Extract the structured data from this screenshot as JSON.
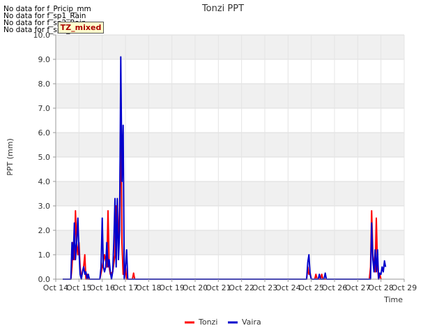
{
  "notes": [
    "No data for f_Pricip_mm",
    "No data for f_sp1_Rain",
    "No data for f_sp2_Rain",
    "No data for f_sp3_Rain"
  ],
  "badge": "TZ_mixed",
  "chart_data": {
    "type": "line",
    "title": "Tonzi PPT",
    "xlabel": "Time",
    "ylabel": "PPT (mm)",
    "xlim": [
      14,
      29
    ],
    "ylim": [
      0,
      10
    ],
    "x_ticks": [
      14,
      15,
      16,
      17,
      18,
      19,
      20,
      21,
      22,
      23,
      24,
      25,
      26,
      27,
      28,
      29
    ],
    "x_tick_labels": [
      "Oct 14",
      "Oct 15",
      "Oct 16",
      "Oct 17",
      "Oct 18",
      "Oct 19",
      "Oct 20",
      "Oct 21",
      "Oct 22",
      "Oct 23",
      "Oct 24",
      "Oct 25",
      "Oct 26",
      "Oct 27",
      "Oct 28",
      "Oct 29"
    ],
    "y_ticks": [
      0,
      1,
      2,
      3,
      4,
      5,
      6,
      7,
      8,
      9,
      10
    ],
    "y_tick_labels": [
      "0.0",
      "1.0",
      "2.0",
      "3.0",
      "4.0",
      "5.0",
      "6.0",
      "7.0",
      "8.0",
      "9.0",
      "10.0"
    ],
    "legend_position": "bottom-center",
    "grid": true,
    "series": [
      {
        "name": "Tonzi",
        "color": "#ff0000",
        "points": [
          [
            14.3,
            0
          ],
          [
            14.65,
            0
          ],
          [
            14.7,
            0.5
          ],
          [
            14.75,
            1.5
          ],
          [
            14.8,
            0.8
          ],
          [
            14.85,
            2.8
          ],
          [
            14.9,
            1.5
          ],
          [
            14.95,
            1.0
          ],
          [
            15.0,
            1.5
          ],
          [
            15.05,
            0.5
          ],
          [
            15.1,
            0
          ],
          [
            15.15,
            0.3
          ],
          [
            15.2,
            0.5
          ],
          [
            15.25,
            1.0
          ],
          [
            15.3,
            0
          ],
          [
            15.35,
            0.2
          ],
          [
            15.4,
            0
          ],
          [
            15.9,
            0
          ],
          [
            16.0,
            0.5
          ],
          [
            16.1,
            1.0
          ],
          [
            16.2,
            0.5
          ],
          [
            16.25,
            2.8
          ],
          [
            16.3,
            0.5
          ],
          [
            16.35,
            0.2
          ],
          [
            16.45,
            0.3
          ],
          [
            16.55,
            1.0
          ],
          [
            16.6,
            3.0
          ],
          [
            16.65,
            2.0
          ],
          [
            16.7,
            1.5
          ],
          [
            16.75,
            3.0
          ],
          [
            16.8,
            6.8
          ],
          [
            16.85,
            1.5
          ],
          [
            16.9,
            0.2
          ],
          [
            17.0,
            0.5
          ],
          [
            17.05,
            0
          ],
          [
            17.3,
            0
          ],
          [
            17.35,
            0.25
          ],
          [
            17.4,
            0
          ],
          [
            24.8,
            0
          ],
          [
            24.85,
            0.5
          ],
          [
            24.9,
            0.2
          ],
          [
            24.95,
            0.25
          ],
          [
            25.0,
            0
          ],
          [
            25.15,
            0
          ],
          [
            25.2,
            0.2
          ],
          [
            25.25,
            0
          ],
          [
            25.4,
            0
          ],
          [
            25.45,
            0.2
          ],
          [
            25.5,
            0
          ],
          [
            27.5,
            0
          ],
          [
            27.55,
            0.5
          ],
          [
            27.6,
            2.8
          ],
          [
            27.65,
            1.0
          ],
          [
            27.7,
            0.5
          ],
          [
            27.75,
            0.3
          ],
          [
            27.8,
            2.5
          ],
          [
            27.85,
            0.5
          ],
          [
            27.9,
            0
          ],
          [
            27.95,
            0.2
          ],
          [
            28.0,
            0
          ]
        ]
      },
      {
        "name": "Vaira",
        "color": "#0000cc",
        "points": [
          [
            14.3,
            0
          ],
          [
            14.65,
            0
          ],
          [
            14.7,
            1.5
          ],
          [
            14.75,
            0.8
          ],
          [
            14.8,
            2.3
          ],
          [
            14.85,
            0.8
          ],
          [
            14.9,
            1.5
          ],
          [
            14.95,
            2.5
          ],
          [
            15.0,
            1.2
          ],
          [
            15.05,
            0.2
          ],
          [
            15.1,
            0
          ],
          [
            15.15,
            0.3
          ],
          [
            15.2,
            0.5
          ],
          [
            15.25,
            0.2
          ],
          [
            15.3,
            0.3
          ],
          [
            15.35,
            0
          ],
          [
            15.4,
            0.2
          ],
          [
            15.45,
            0
          ],
          [
            15.9,
            0
          ],
          [
            15.95,
            0.5
          ],
          [
            16.0,
            2.5
          ],
          [
            16.05,
            0.5
          ],
          [
            16.1,
            0.3
          ],
          [
            16.15,
            0.5
          ],
          [
            16.2,
            1.5
          ],
          [
            16.25,
            0.5
          ],
          [
            16.3,
            0.8
          ],
          [
            16.35,
            0.3
          ],
          [
            16.4,
            0
          ],
          [
            16.45,
            0.3
          ],
          [
            16.5,
            1.5
          ],
          [
            16.55,
            3.3
          ],
          [
            16.6,
            0.5
          ],
          [
            16.65,
            3.3
          ],
          [
            16.7,
            0.8
          ],
          [
            16.75,
            2.0
          ],
          [
            16.8,
            9.1
          ],
          [
            16.85,
            4.0
          ],
          [
            16.9,
            6.3
          ],
          [
            16.95,
            0
          ],
          [
            17.0,
            0.5
          ],
          [
            17.05,
            1.2
          ],
          [
            17.1,
            0
          ],
          [
            24.8,
            0
          ],
          [
            24.85,
            0.7
          ],
          [
            24.9,
            1.0
          ],
          [
            24.95,
            0.2
          ],
          [
            25.0,
            0
          ],
          [
            25.3,
            0
          ],
          [
            25.35,
            0.2
          ],
          [
            25.4,
            0
          ],
          [
            25.55,
            0
          ],
          [
            25.6,
            0.25
          ],
          [
            25.65,
            0
          ],
          [
            27.55,
            0
          ],
          [
            27.6,
            2.3
          ],
          [
            27.65,
            0.8
          ],
          [
            27.7,
            0.3
          ],
          [
            27.75,
            1.2
          ],
          [
            27.8,
            0.3
          ],
          [
            27.85,
            1.2
          ],
          [
            27.9,
            0
          ],
          [
            27.95,
            0.25
          ],
          [
            28.0,
            0.2
          ],
          [
            28.05,
            0.5
          ],
          [
            28.1,
            0.3
          ],
          [
            28.15,
            0.75
          ],
          [
            28.2,
            0.5
          ]
        ]
      }
    ]
  }
}
